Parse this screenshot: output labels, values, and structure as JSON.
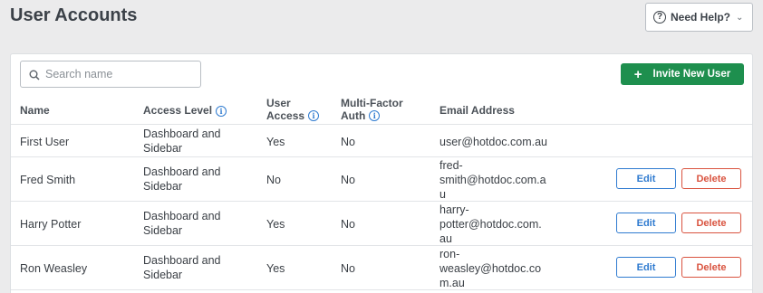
{
  "page": {
    "title": "User Accounts"
  },
  "help": {
    "label": "Need Help?",
    "icon": "question-circle-icon",
    "chevron": "chevron-down-icon"
  },
  "search": {
    "placeholder": "Search name",
    "value": ""
  },
  "invite": {
    "label": "Invite New User",
    "icon": "plus-icon",
    "color": "#1e8f4e"
  },
  "table": {
    "headers": {
      "name": "Name",
      "access_level": "Access Level",
      "user_access_line1": "User",
      "user_access_line2": "Access",
      "mfa_line1": "Multi-Factor",
      "mfa_line2": "Auth",
      "email": "Email Address"
    },
    "rows": [
      {
        "name": "First User",
        "access_line1": "Dashboard and",
        "access_line2": "Sidebar",
        "user_access": "Yes",
        "mfa": "No",
        "email_lines": [
          "user@hotdoc.com.au"
        ]
      },
      {
        "name": "Fred Smith",
        "access_line1": "Dashboard and",
        "access_line2": "Sidebar",
        "user_access": "No",
        "mfa": "No",
        "email_lines": [
          "fred-",
          "smith@hotdoc.com.a",
          "u"
        ],
        "edit": "Edit",
        "delete": "Delete"
      },
      {
        "name": "Harry Potter",
        "access_line1": "Dashboard and",
        "access_line2": "Sidebar",
        "user_access": "Yes",
        "mfa": "No",
        "email_lines": [
          "harry-",
          "potter@hotdoc.com.",
          "au"
        ],
        "edit": "Edit",
        "delete": "Delete"
      },
      {
        "name": "Ron Weasley",
        "access_line1": "Dashboard and",
        "access_line2": "Sidebar",
        "user_access": "Yes",
        "mfa": "No",
        "email_lines": [
          "ron-",
          "weasley@hotdoc.co",
          "m.au"
        ],
        "edit": "Edit",
        "delete": "Delete"
      }
    ]
  },
  "colors": {
    "edit": "#2f7bd0",
    "delete": "#d9533f",
    "info": "#2f7bd0"
  }
}
